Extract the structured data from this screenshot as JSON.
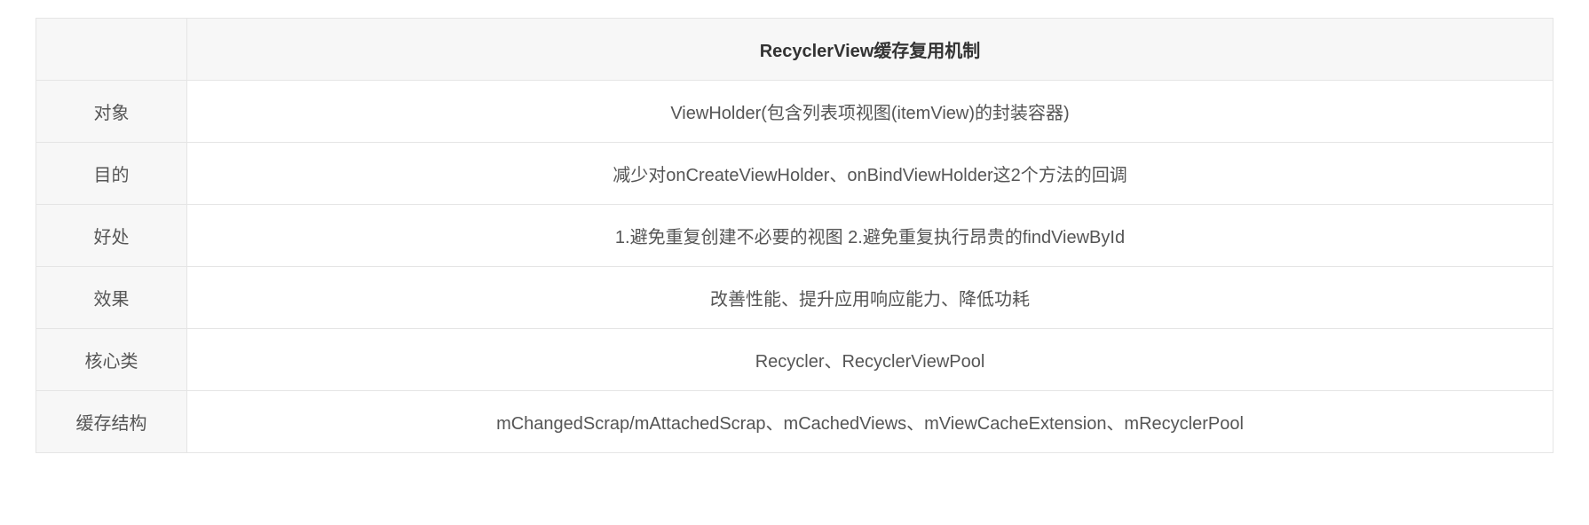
{
  "table": {
    "header": {
      "col1": "",
      "col2": "RecyclerView缓存复用机制"
    },
    "rows": [
      {
        "label": "对象",
        "value": "ViewHolder(包含列表项视图(itemView)的封装容器)"
      },
      {
        "label": "目的",
        "value": "减少对onCreateViewHolder、onBindViewHolder这2个方法的回调"
      },
      {
        "label": "好处",
        "value": "1.避免重复创建不必要的视图 2.避免重复执行昂贵的findViewById"
      },
      {
        "label": "效果",
        "value": "改善性能、提升应用响应能力、降低功耗"
      },
      {
        "label": "核心类",
        "value": "Recycler、RecyclerViewPool"
      },
      {
        "label": "缓存结构",
        "value": "mChangedScrap/mAttachedScrap、mCachedViews、mViewCacheExtension、mRecyclerPool"
      }
    ]
  }
}
